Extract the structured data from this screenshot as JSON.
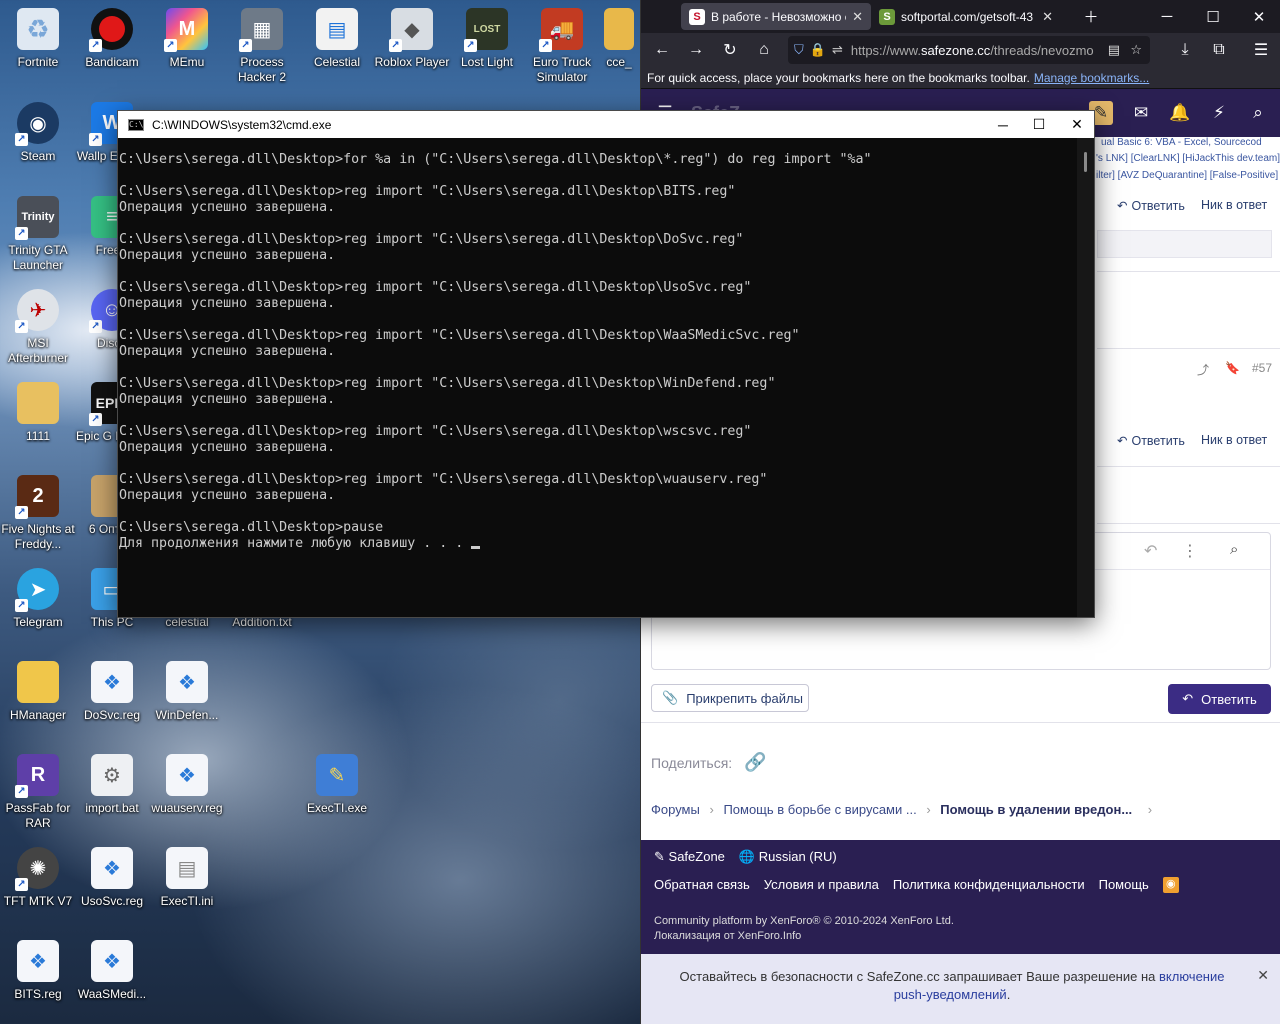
{
  "desktop": {
    "icons": [
      {
        "label": "Fortnite"
      },
      {
        "label": "Bandicam"
      },
      {
        "label": "MEmu"
      },
      {
        "label": "Process Hacker 2"
      },
      {
        "label": "Celestial"
      },
      {
        "label": "Roblox Player"
      },
      {
        "label": "Lost Light"
      },
      {
        "label": "Euro Truck Simulator"
      },
      {
        "label": "cce_"
      },
      {
        "label": "Steam"
      },
      {
        "label": "Wallp Engine"
      },
      {
        "label": "Trinity GTA Launcher"
      },
      {
        "label": "FreeV"
      },
      {
        "label": "MSI Afterburner"
      },
      {
        "label": "Disco"
      },
      {
        "label": "1111"
      },
      {
        "label": "Epic G Launc"
      },
      {
        "label": "Five Nights at Freddy..."
      },
      {
        "label": "6 Оптим"
      },
      {
        "label": "Telegram"
      },
      {
        "label": "This PC"
      },
      {
        "label": "celestial"
      },
      {
        "label": "Addition.txt"
      },
      {
        "label": "HManager"
      },
      {
        "label": "DoSvc.reg"
      },
      {
        "label": "WinDefen..."
      },
      {
        "label": "PassFab for RAR"
      },
      {
        "label": "import.bat"
      },
      {
        "label": "wuauserv.reg"
      },
      {
        "label": "ExecTI.exe"
      },
      {
        "label": "TFT MTK V7"
      },
      {
        "label": "UsoSvc.reg"
      },
      {
        "label": "ExecTI.ini"
      },
      {
        "label": "BITS.reg"
      },
      {
        "label": "WaaSMedi..."
      }
    ]
  },
  "cmd": {
    "title": "C:\\WINDOWS\\system32\\cmd.exe",
    "lines": [
      "C:\\Users\\serega.dll\\Desktop>for %a in (\"C:\\Users\\serega.dll\\Desktop\\*.reg\") do reg import \"%a\"",
      "",
      "C:\\Users\\serega.dll\\Desktop>reg import \"C:\\Users\\serega.dll\\Desktop\\BITS.reg\"",
      "Операция успешно завершена.",
      "",
      "C:\\Users\\serega.dll\\Desktop>reg import \"C:\\Users\\serega.dll\\Desktop\\DoSvc.reg\"",
      "Операция успешно завершена.",
      "",
      "C:\\Users\\serega.dll\\Desktop>reg import \"C:\\Users\\serega.dll\\Desktop\\UsoSvc.reg\"",
      "Операция успешно завершена.",
      "",
      "C:\\Users\\serega.dll\\Desktop>reg import \"C:\\Users\\serega.dll\\Desktop\\WaaSMedicSvc.reg\"",
      "Операция успешно завершена.",
      "",
      "C:\\Users\\serega.dll\\Desktop>reg import \"C:\\Users\\serega.dll\\Desktop\\WinDefend.reg\"",
      "Операция успешно завершена.",
      "",
      "C:\\Users\\serega.dll\\Desktop>reg import \"C:\\Users\\serega.dll\\Desktop\\wscsvc.reg\"",
      "Операция успешно завершена.",
      "",
      "C:\\Users\\serega.dll\\Desktop>reg import \"C:\\Users\\serega.dll\\Desktop\\wuauserv.reg\"",
      "Операция успешно завершена.",
      "",
      "C:\\Users\\serega.dll\\Desktop>pause",
      "Для продолжения нажмите любую клавишу . . . "
    ]
  },
  "browser": {
    "tabs": [
      {
        "title": "В работе - Невозможно с"
      },
      {
        "title": "softportal.com/getsoft-43"
      }
    ],
    "url_prefix": "https://www.",
    "url_domain": "safezone.cc",
    "url_rest": "/threads/nevozmo",
    "bookmarks_hint": "For quick access, place your bookmarks here on the bookmarks toolbar.",
    "manage_bookmarks": "Manage bookmarks...",
    "site_logo_text": "SafeZ",
    "top_link_text": "ual Basic 6: VBA - Excel, Sourcecod",
    "tool_links": "'s LNK]  [ClearLNK]  [HiJackThis dev.team]",
    "tool_links2": "ilter]  [AVZ DeQuarantine]  [False-Positive]",
    "reply_label": "Ответить",
    "nick_reply_label": "Ник в ответ",
    "post_number": "#57",
    "attach_label": "Прикрепить файлы",
    "submit_label": "Ответить",
    "share_label": "Поделиться:",
    "breadcrumbs": [
      "Форумы",
      "Помощь в борьбе с вирусами ...",
      "Помощь в удалении вредон..."
    ],
    "footer": {
      "brand": "SafeZone",
      "language": "Russian (RU)",
      "links": [
        "Обратная связь",
        "Условия и правила",
        "Политика конфиденциальности",
        "Помощь"
      ],
      "copyright": "Community platform by XenForo® © 2010-2024 XenForo Ltd.",
      "localization": "Локализация от XenForo.Info"
    },
    "notice_text": "Оставайтесь в безопасности с SafeZone.cc запрашивает Ваше разрешение на",
    "notice_link": "включение push-уведомлений",
    "notice_end": "."
  },
  "colors": {
    "site_header": "#2a1f52",
    "primary_button": "#3b2c84",
    "cmd_bg": "#0c0c0c",
    "cmd_fg": "#cccccc"
  }
}
